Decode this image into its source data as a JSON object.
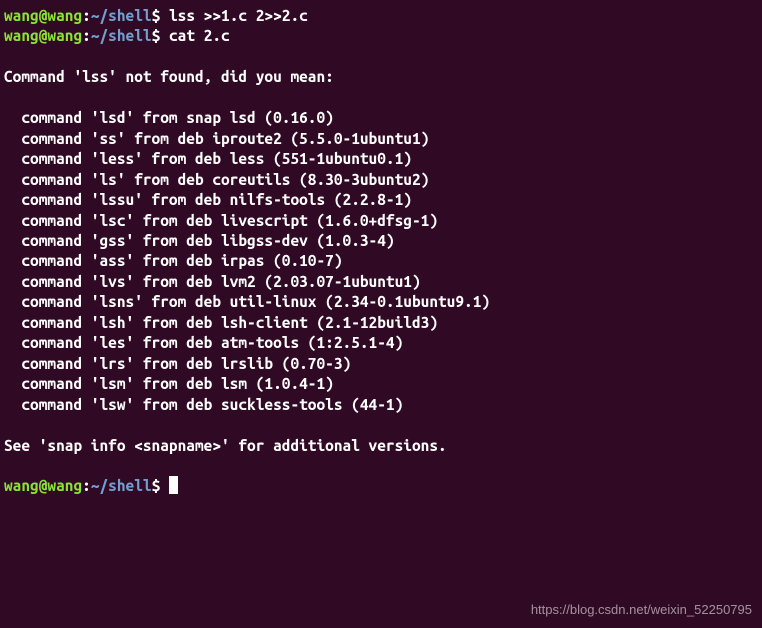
{
  "prompt": {
    "user_host": "wang@wang",
    "colon": ":",
    "path": "~/shell",
    "dollar": "$"
  },
  "commands": [
    "lss >>1.c 2>>2.c",
    "cat 2.c"
  ],
  "error_header": "Command 'lss' not found, did you mean:",
  "suggestions": [
    "  command 'lsd' from snap lsd (0.16.0)",
    "  command 'ss' from deb iproute2 (5.5.0-1ubuntu1)",
    "  command 'less' from deb less (551-1ubuntu0.1)",
    "  command 'ls' from deb coreutils (8.30-3ubuntu2)",
    "  command 'lssu' from deb nilfs-tools (2.2.8-1)",
    "  command 'lsc' from deb livescript (1.6.0+dfsg-1)",
    "  command 'gss' from deb libgss-dev (1.0.3-4)",
    "  command 'ass' from deb irpas (0.10-7)",
    "  command 'lvs' from deb lvm2 (2.03.07-1ubuntu1)",
    "  command 'lsns' from deb util-linux (2.34-0.1ubuntu9.1)",
    "  command 'lsh' from deb lsh-client (2.1-12build3)",
    "  command 'les' from deb atm-tools (1:2.5.1-4)",
    "  command 'lrs' from deb lrslib (0.70-3)",
    "  command 'lsm' from deb lsm (1.0.4-1)",
    "  command 'lsw' from deb suckless-tools (44-1)"
  ],
  "footer": "See 'snap info <snapname>' for additional versions.",
  "watermark": "https://blog.csdn.net/weixin_52250795"
}
